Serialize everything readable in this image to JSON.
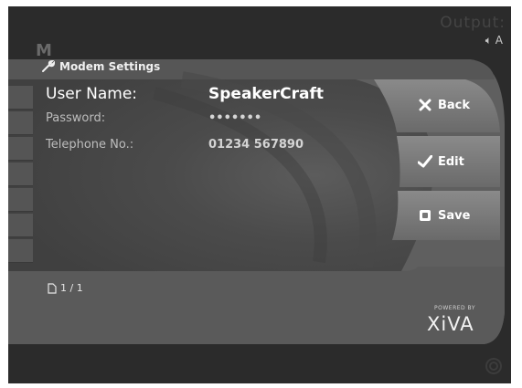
{
  "header": {
    "title": "Modem Settings",
    "output_label": "Output:",
    "speaker_label": "A"
  },
  "fields": [
    {
      "label": "User Name:",
      "value": "SpeakerCraft"
    },
    {
      "label": "Password:",
      "value": "•••••••"
    },
    {
      "label": "Telephone No.:",
      "value": "01234 567890"
    }
  ],
  "buttons": {
    "back": "Back",
    "edit": "Edit",
    "save": "Save"
  },
  "pagination": {
    "label": "1 / 1"
  },
  "branding": {
    "powered_by": "POWERED BY",
    "logo": "XiVA"
  },
  "colors": {
    "panel": "#666666",
    "buttons": "#7a7a7a",
    "background": "#2b2b2b"
  }
}
